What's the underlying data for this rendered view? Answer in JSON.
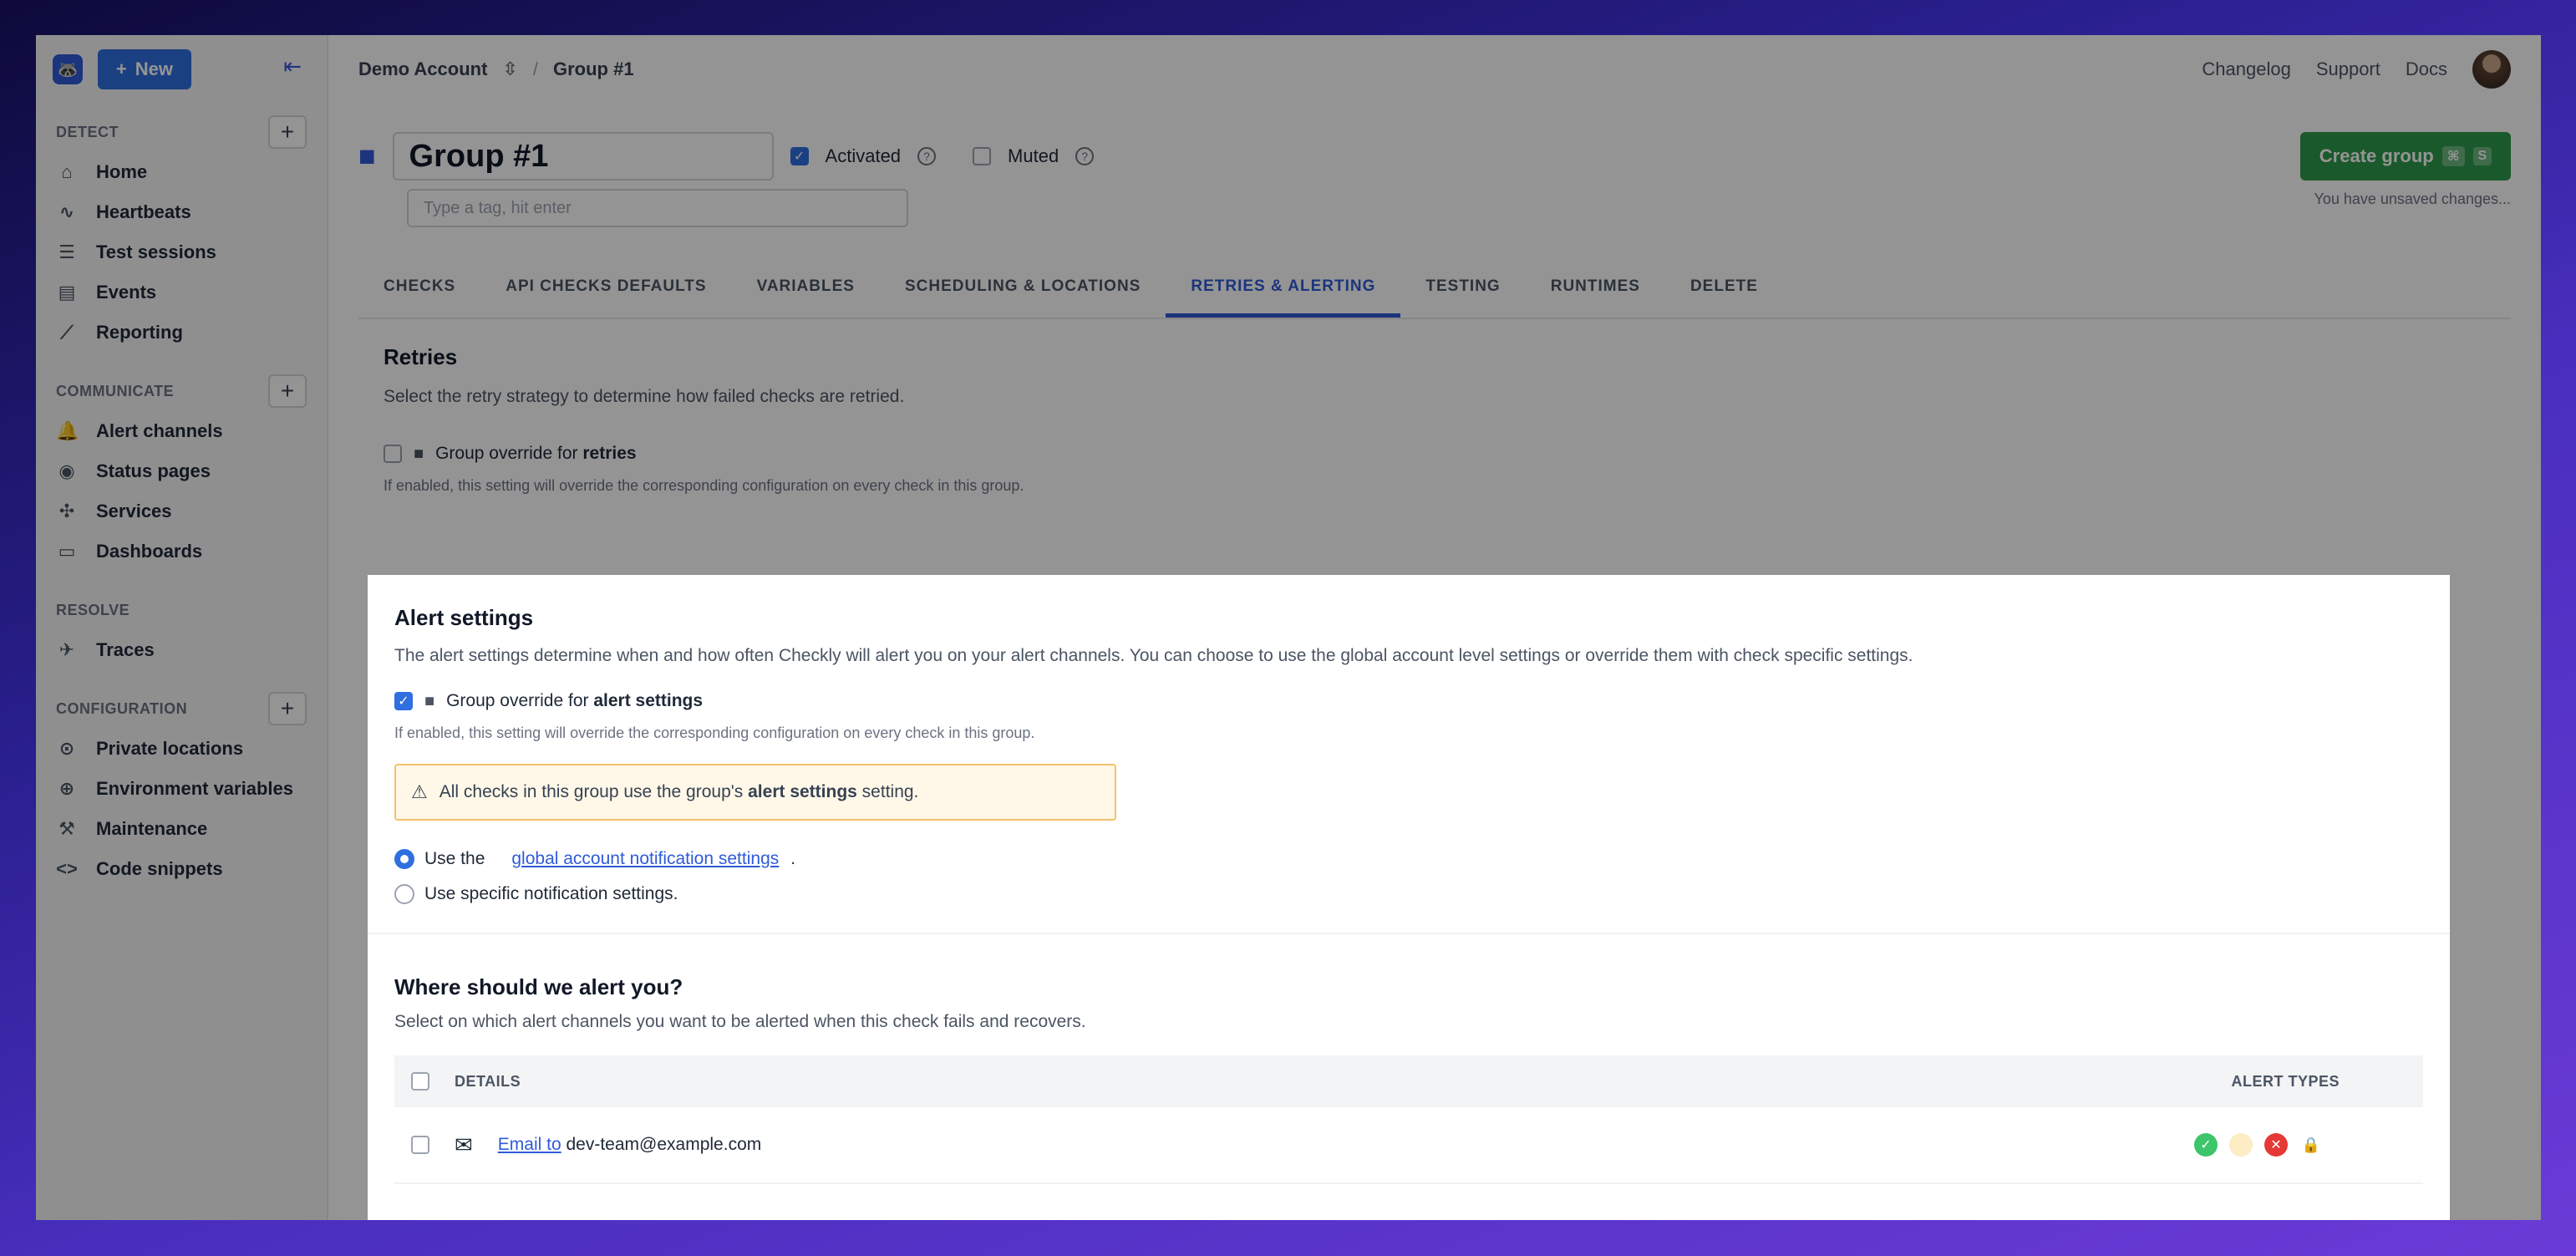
{
  "header": {
    "new_label": "New",
    "account": "Demo Account",
    "crumb_sep": "/",
    "group": "Group #1",
    "links": [
      "Changelog",
      "Support",
      "Docs"
    ]
  },
  "sidebar": {
    "sections": [
      {
        "title": "DETECT",
        "items": [
          {
            "label": "Home",
            "icon": "home-icon"
          },
          {
            "label": "Heartbeats",
            "icon": "pulse-icon"
          },
          {
            "label": "Test sessions",
            "icon": "list-icon"
          },
          {
            "label": "Events",
            "icon": "events-icon"
          },
          {
            "label": "Reporting",
            "icon": "chart-icon"
          }
        ]
      },
      {
        "title": "COMMUNICATE",
        "items": [
          {
            "label": "Alert channels",
            "icon": "bell-icon"
          },
          {
            "label": "Status pages",
            "icon": "broadcast-icon"
          },
          {
            "label": "Services",
            "icon": "services-icon"
          },
          {
            "label": "Dashboards",
            "icon": "monitor-icon"
          }
        ]
      },
      {
        "title": "RESOLVE",
        "items": [
          {
            "label": "Traces",
            "icon": "traces-icon"
          }
        ]
      },
      {
        "title": "CONFIGURATION",
        "items": [
          {
            "label": "Private locations",
            "icon": "pin-icon"
          },
          {
            "label": "Environment variables",
            "icon": "globe-icon"
          },
          {
            "label": "Maintenance",
            "icon": "wrench-icon"
          },
          {
            "label": "Code snippets",
            "icon": "code-icon"
          }
        ]
      }
    ]
  },
  "group": {
    "name": "Group #1",
    "activated_label": "Activated",
    "muted_label": "Muted",
    "tag_placeholder": "Type a tag, hit enter",
    "create_label": "Create group",
    "kbd1": "⌘",
    "kbd2": "S",
    "unsaved": "You have unsaved changes..."
  },
  "tabs": [
    "CHECKS",
    "API CHECKS DEFAULTS",
    "VARIABLES",
    "SCHEDULING & LOCATIONS",
    "RETRIES & ALERTING",
    "TESTING",
    "RUNTIMES",
    "DELETE"
  ],
  "retries": {
    "title": "Retries",
    "desc": "Select the retry strategy to determine how failed checks are retried.",
    "override_prefix": "Group override for ",
    "override_bold": "retries",
    "hint": "If enabled, this setting will override the corresponding configuration on every check in this group."
  },
  "alerts": {
    "title": "Alert settings",
    "desc": "The alert settings determine when and how often Checkly will alert you on your alert channels. You can choose to use the global account level settings or override them with check specific settings.",
    "override_prefix": "Group override for ",
    "override_bold": "alert settings",
    "hint": "If enabled, this setting will override the corresponding configuration on every check in this group.",
    "warn_prefix": "All checks in this group use the group's ",
    "warn_bold": "alert settings",
    "warn_suffix": " setting.",
    "radio1_prefix": "Use the",
    "radio1_link": "global account notification settings",
    "radio1_suffix": ".",
    "radio2": "Use specific notification settings."
  },
  "where": {
    "title": "Where should we alert you?",
    "desc": "Select on which alert channels you want to be alerted when this check fails and recovers.",
    "col_details": "DETAILS",
    "col_types": "ALERT TYPES",
    "row_link": "Email to",
    "row_email": "dev-team@example.com"
  }
}
